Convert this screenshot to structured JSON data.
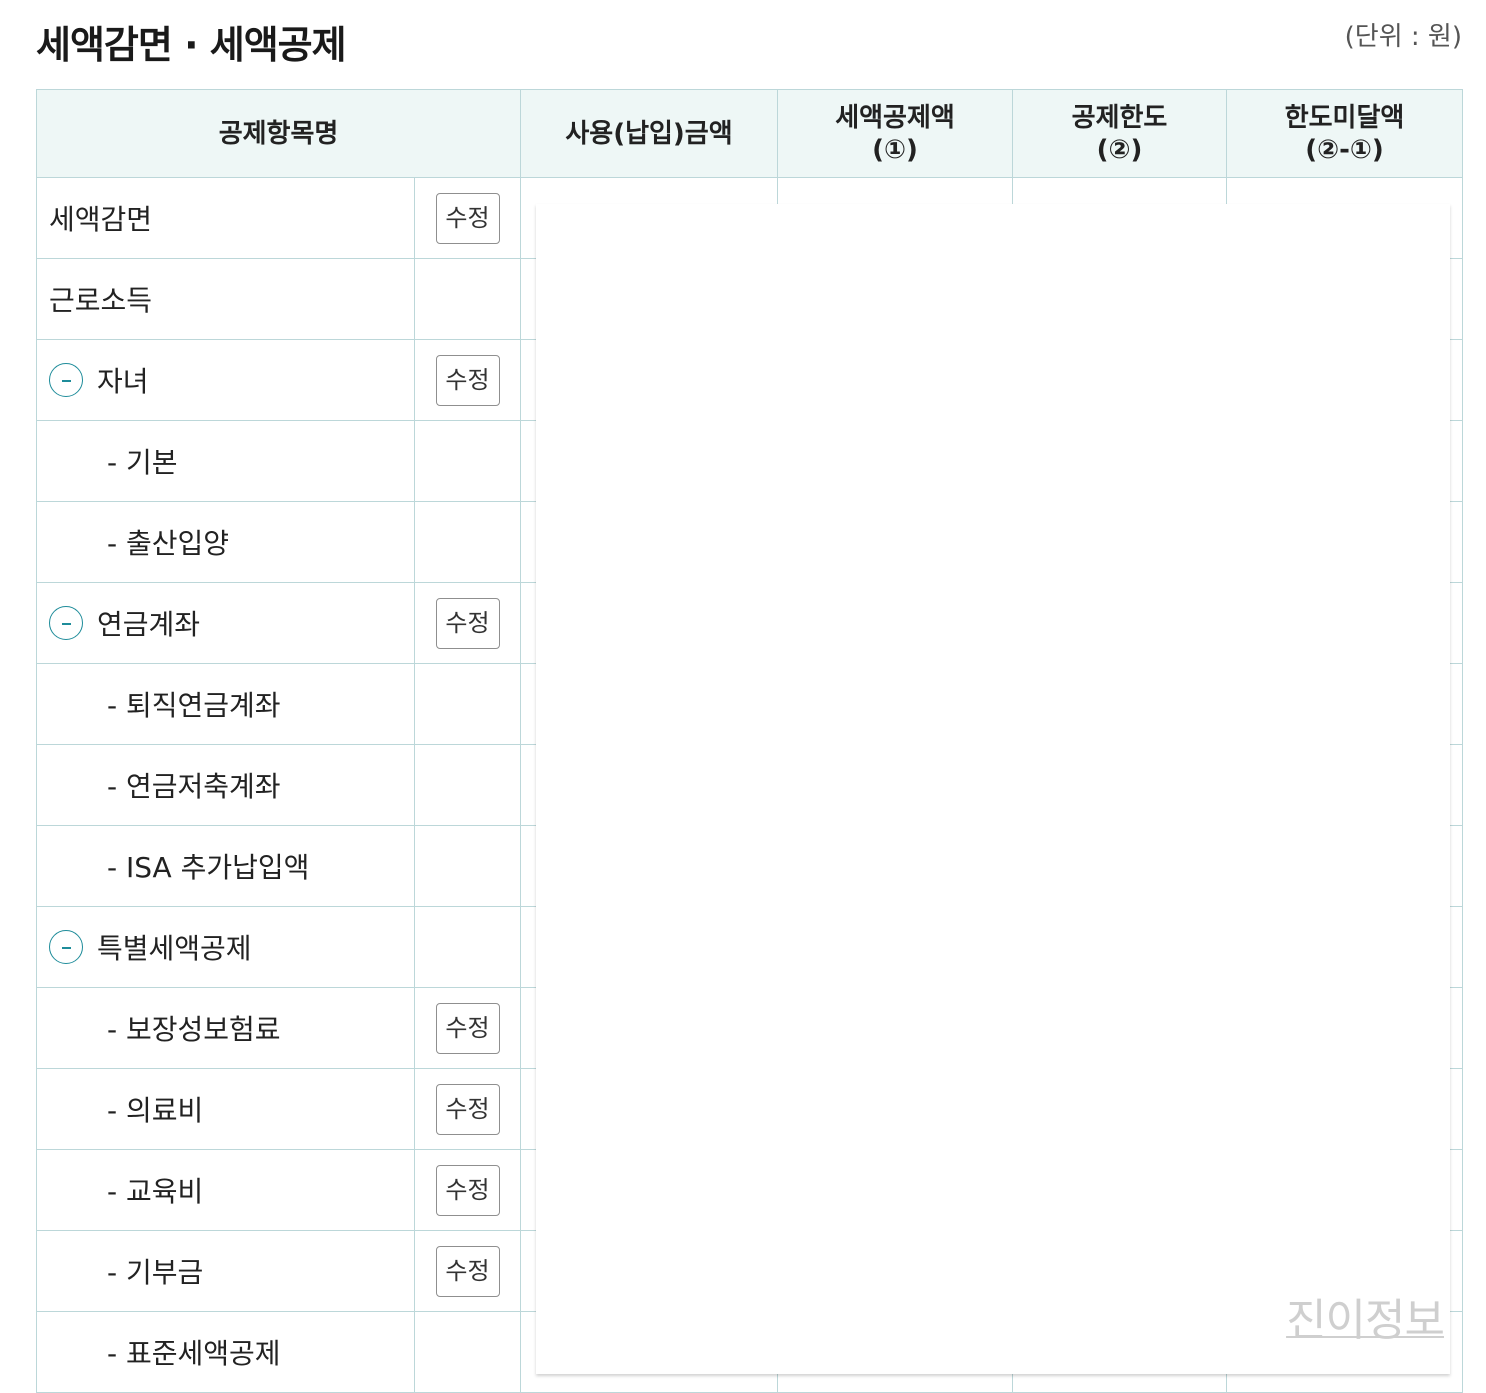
{
  "page": {
    "title": "세액감면 · 세액공제",
    "unit": "(단위 : 원)"
  },
  "table": {
    "headers": {
      "item": "공제항목명",
      "used_amount": "사용(납입)금액",
      "credit_amount_line1": "세액공제액",
      "credit_amount_line2": "(①)",
      "limit_line1": "공제한도",
      "limit_line2": "(②)",
      "shortfall_line1": "한도미달액",
      "shortfall_line2": "(②-①)"
    },
    "edit_label": "수정",
    "rows": [
      {
        "label": "세액감면",
        "level": 0,
        "collapsible": false,
        "editable": true
      },
      {
        "label": "근로소득",
        "level": 0,
        "collapsible": false,
        "editable": false
      },
      {
        "label": "자녀",
        "level": 0,
        "collapsible": true,
        "editable": true
      },
      {
        "label": "- 기본",
        "level": 1,
        "collapsible": false,
        "editable": false
      },
      {
        "label": "- 출산입양",
        "level": 1,
        "collapsible": false,
        "editable": false
      },
      {
        "label": "연금계좌",
        "level": 0,
        "collapsible": true,
        "editable": true
      },
      {
        "label": "- 퇴직연금계좌",
        "level": 1,
        "collapsible": false,
        "editable": false
      },
      {
        "label": "- 연금저축계좌",
        "level": 1,
        "collapsible": false,
        "editable": false
      },
      {
        "label": "- ISA 추가납입액",
        "level": 1,
        "collapsible": false,
        "editable": false
      },
      {
        "label": "특별세액공제",
        "level": 0,
        "collapsible": true,
        "editable": false
      },
      {
        "label": "- 보장성보험료",
        "level": 1,
        "collapsible": false,
        "editable": true
      },
      {
        "label": "- 의료비",
        "level": 1,
        "collapsible": false,
        "editable": true
      },
      {
        "label": "- 교육비",
        "level": 1,
        "collapsible": false,
        "editable": true
      },
      {
        "label": "- 기부금",
        "level": 1,
        "collapsible": false,
        "editable": true
      },
      {
        "label": "- 표준세액공제",
        "level": 1,
        "collapsible": false,
        "editable": false
      }
    ]
  },
  "overlay": {
    "watermark": "진이정보"
  }
}
